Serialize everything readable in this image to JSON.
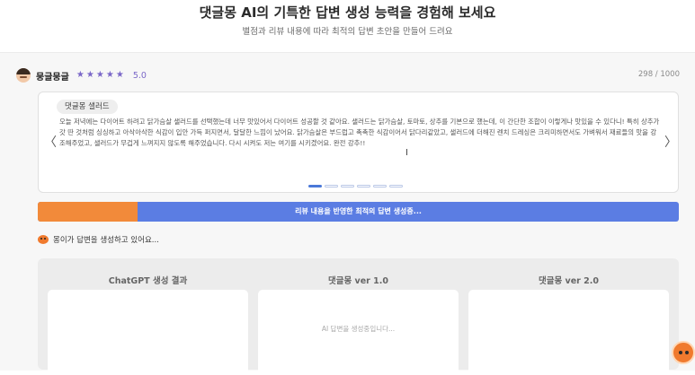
{
  "hero": {
    "title": "댓글몽 AI의 기특한 답변 생성 능력을 경험해 보세요",
    "subtitle": "별점과 리뷰 내용에 따라 최적의 답변 초안을 만들어 드려요"
  },
  "review": {
    "username": "뭉글뭉글",
    "rating": "5.0",
    "char_count": "298 / 1000",
    "menu_chip": "댓글몽 샐러드",
    "text": "오늘 저녁에는 다이어트 하려고 닭가슴살 샐러드를 선택했는데 너무 맛있어서 다이어트 성공할 것 같아요. 샐러드는 닭가슴살, 토마토, 상추를 기본으로 했는데, 이 간단한 조합이 이렇게나 맛있을 수 있다니! 특히 상추가 갓 딴 것처럼 싱싱하고 아삭아삭한 식감이 입안 가득 퍼지면서, 달달한 느낌이 났어요. 닭가슴살은 부드럽고 촉촉한 식감이어서 닭다리같았고, 샐러드에 더해진 렌치 드레싱은 크리미하면서도 가벼워서 재료들의 맛을 강조해주었고, 샐러드가 무겁게 느껴지지 않도록 해주었습니다. 다시 시켜도 저는 여기를 시키겠어요. 완전 강추!!",
    "nav_left": "〈",
    "nav_right": "〉",
    "carousel_active_index": 0,
    "carousel_count": 6
  },
  "progress": {
    "label": "리뷰 내용을 반영한 최적의 답변 생성중...",
    "fraction": 0.155,
    "fill_color": "#f28a3a",
    "track_color": "#5b7de3"
  },
  "status": {
    "text": "몽이가 답변을 생성하고 있어요..."
  },
  "results": {
    "columns": [
      {
        "title": "ChatGPT 생성 결과",
        "placeholder": ""
      },
      {
        "title": "댓글몽 ver 1.0",
        "placeholder": "AI 답변을 생성중입니다..."
      },
      {
        "title": "댓글몽 ver 2.0",
        "placeholder": ""
      }
    ]
  },
  "icons": {
    "avatar": "user-avatar-icon",
    "star": "star-icon",
    "mascot": "mascot-icon",
    "chat_fab": "chat-mascot-icon",
    "cursor": "text-cursor-icon"
  },
  "colors": {
    "accent_blue": "#4a78d8",
    "accent_orange": "#f28a3a",
    "star_purple": "#7b68c8"
  }
}
